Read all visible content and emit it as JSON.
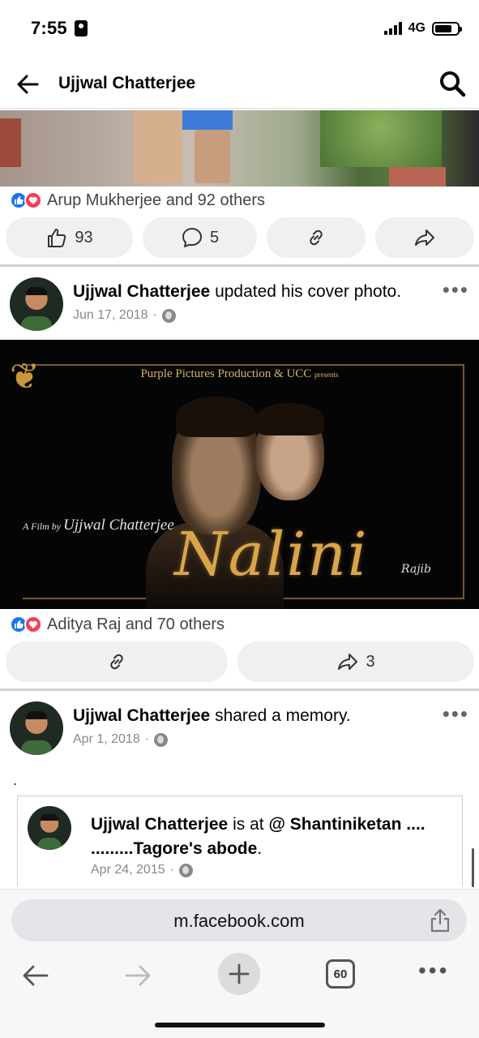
{
  "status_bar": {
    "time": "7:55",
    "network": "4G"
  },
  "header": {
    "title": "Ujjwal Chatterjee"
  },
  "post1": {
    "reactions_text": "Arup Mukherjee and 92 others",
    "like_count": "93",
    "comment_count": "5"
  },
  "post2": {
    "author": "Ujjwal Chatterjee",
    "action": "updated his cover photo.",
    "date": "Jun 17, 2018",
    "cover": {
      "producer": "Purple Pictures Production & UCC",
      "presents": "presents",
      "a_film_by": "A Film by",
      "director": "Ujjwal Chatterjee",
      "film_title": "Nalini",
      "signature": "Rajib"
    },
    "reactions_text": "Aditya Raj and 70 others",
    "share_count": "3"
  },
  "post3": {
    "author": "Ujjwal Chatterjee",
    "action": "shared a memory.",
    "date": "Apr 1, 2018",
    "body": ".",
    "memory": {
      "author": "Ujjwal Chatterjee",
      "is_at": "is at",
      "place": "@ Shantiniketan .... .........Tagore's abode",
      "period": ".",
      "date": "Apr 24, 2015"
    }
  },
  "browser": {
    "url": "m.facebook.com",
    "tab_count": "60"
  },
  "colors": {
    "like_blue": "#1877f2",
    "love_red": "#f33e58",
    "gold": "#d9a54a"
  }
}
